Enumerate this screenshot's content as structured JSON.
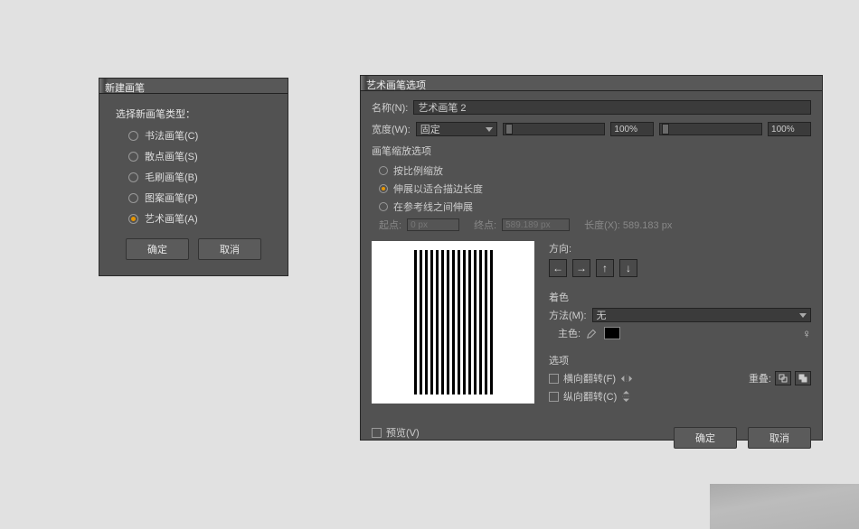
{
  "dlg1": {
    "title": "新建画笔",
    "section": "选择新画笔类型：",
    "items": [
      {
        "label": "书法画笔(C)"
      },
      {
        "label": "散点画笔(S)"
      },
      {
        "label": "毛刷画笔(B)"
      },
      {
        "label": "图案画笔(P)"
      },
      {
        "label": "艺术画笔(A)"
      }
    ],
    "ok": "确定",
    "cancel": "取消"
  },
  "dlg2": {
    "title": "艺术画笔选项",
    "name_label": "名称(N):",
    "name_value": "艺术画笔 2",
    "width_label": "宽度(W):",
    "width_mode": "固定",
    "width_value1": "100%",
    "width_value2": "100%",
    "scale_group": "画笔缩放选项",
    "scale_opts": [
      {
        "label": "按比例缩放"
      },
      {
        "label": "伸展以适合描边长度"
      },
      {
        "label": "在参考线之间伸展"
      }
    ],
    "start_label": "起点:",
    "start_value": "0 px",
    "end_label": "终点:",
    "end_value": "589.189 px",
    "length_label": "长度(X): 589.183 px",
    "direction_title": "方向:",
    "color_title": "着色",
    "method_label": "方法(M):",
    "method_value": "无",
    "keycolor_label": "主色:",
    "options_title": "选项",
    "flip_h": "横向翻转(F)",
    "flip_v": "纵向翻转(C)",
    "overlap_label": "重叠:",
    "preview_cb": "预览(V)",
    "ok": "确定",
    "cancel": "取消"
  }
}
